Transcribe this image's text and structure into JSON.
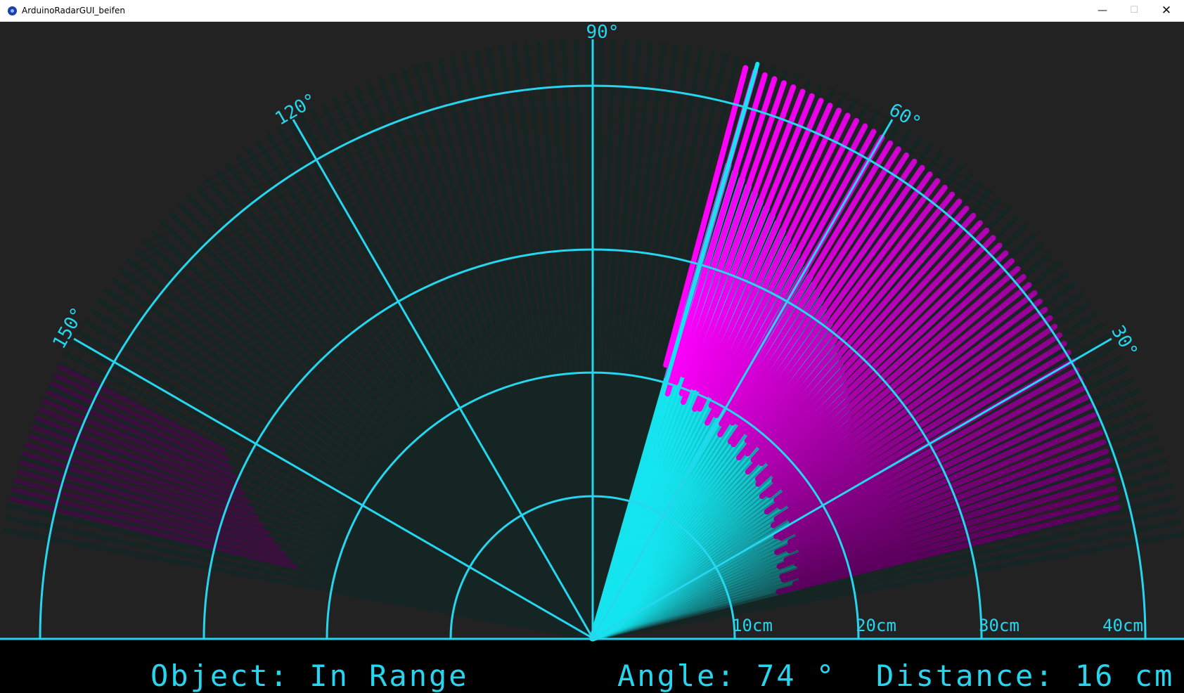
{
  "window": {
    "title": "ArduinoRadarGUI_beifen",
    "minimize_symbol": "—",
    "maximize_symbol": "☐",
    "close_symbol": "✕"
  },
  "radar": {
    "angle_labels": [
      "90°",
      "120°",
      "60°",
      "150°",
      "30°"
    ],
    "range_labels": [
      "10cm",
      "20cm",
      "30cm",
      "40cm"
    ]
  },
  "status": {
    "object": "Object: In Range",
    "angle": "Angle: 74 °",
    "distance": "Distance: 16 cm"
  },
  "readout": {
    "current_angle_deg": 74,
    "current_distance_cm": 16
  },
  "colors": {
    "grid": "#26d6ef",
    "sweep": "#14e6f0",
    "object": "#ff00ff",
    "background": "#222222",
    "text": "#26d6ef"
  }
}
